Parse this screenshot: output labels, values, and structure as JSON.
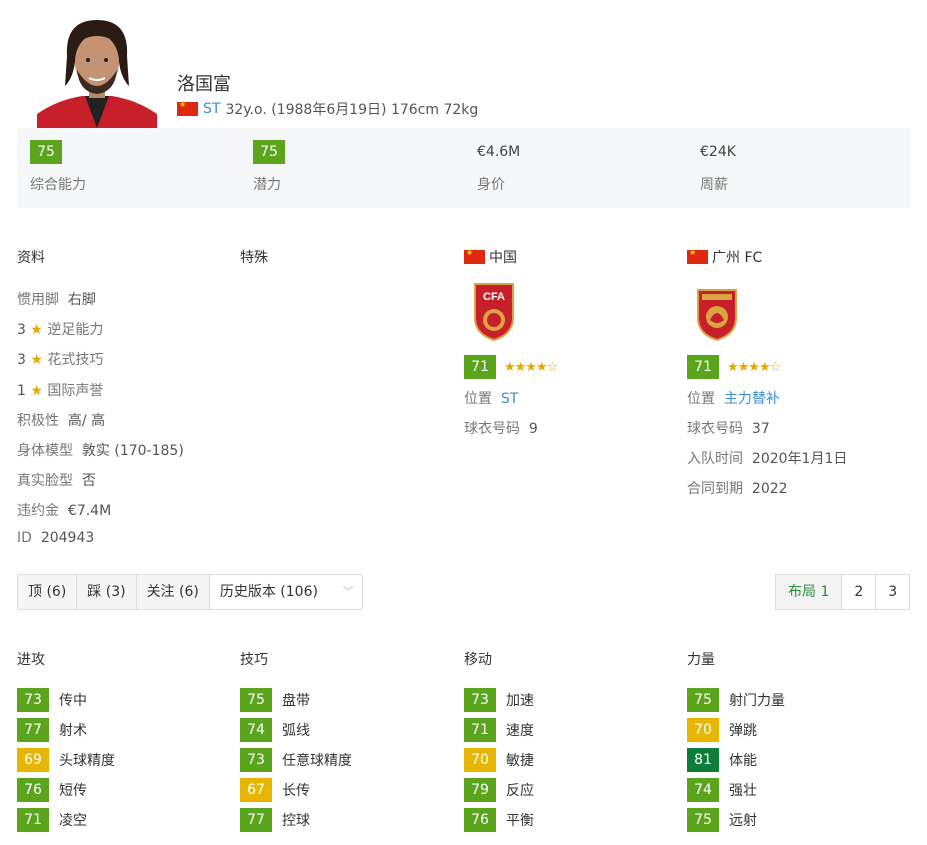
{
  "player": {
    "name": "洛国富",
    "position": "ST",
    "details": "32y.o. (1988年6月19日) 176cm 72kg"
  },
  "summary": [
    {
      "value": "75",
      "label": "综合能力",
      "color": "#5aa51c",
      "boxed": true
    },
    {
      "value": "75",
      "label": "潜力",
      "color": "#5aa51c",
      "boxed": true
    },
    {
      "value": "€4.6M",
      "label": "身价",
      "boxed": false
    },
    {
      "value": "€24K",
      "label": "周薪",
      "boxed": false
    }
  ],
  "profile": {
    "title": "资料",
    "preferred_foot_label": "惯用脚",
    "preferred_foot": "右脚",
    "weak_foot_num": "3",
    "weak_foot_label": "逆足能力",
    "skill_moves_num": "3",
    "skill_moves_label": "花式技巧",
    "reputation_num": "1",
    "reputation_label": "国际声誉",
    "work_rate_label": "积极性",
    "work_rate": "高/ 高",
    "body_label": "身体模型",
    "body": "敦实 (170-185)",
    "real_face_label": "真实脸型",
    "real_face": "否",
    "release_label": "违约金",
    "release": "€7.4M",
    "id_label": "ID",
    "id": "204943"
  },
  "traits": {
    "title": "特殊"
  },
  "national": {
    "name": "中国",
    "rating": "71",
    "stars": "★★★★☆",
    "position_label": "位置",
    "position": "ST",
    "number_label": "球衣号码",
    "number": "9"
  },
  "club": {
    "name": "广州 FC",
    "rating": "71",
    "stars": "★★★★☆",
    "position_label": "位置",
    "position": "主力替补",
    "number_label": "球衣号码",
    "number": "37",
    "joined_label": "入队时间",
    "joined": "2020年1月1日",
    "contract_label": "合同到期",
    "contract": "2022"
  },
  "actions": {
    "like": "顶 (6)",
    "dislike": "踩 (3)",
    "follow": "关注 (6)",
    "history": "历史版本 (106)"
  },
  "layout_pager": {
    "label": "布局 1",
    "p2": "2",
    "p3": "3"
  },
  "attributes": {
    "attacking": {
      "title": "进攻",
      "items": [
        {
          "v": "73",
          "l": "传中",
          "c": "g"
        },
        {
          "v": "77",
          "l": "射术",
          "c": "g"
        },
        {
          "v": "69",
          "l": "头球精度",
          "c": "y"
        },
        {
          "v": "76",
          "l": "短传",
          "c": "g"
        },
        {
          "v": "71",
          "l": "凌空",
          "c": "g"
        }
      ]
    },
    "skill": {
      "title": "技巧",
      "items": [
        {
          "v": "75",
          "l": "盘带",
          "c": "g"
        },
        {
          "v": "74",
          "l": "弧线",
          "c": "g"
        },
        {
          "v": "73",
          "l": "任意球精度",
          "c": "g"
        },
        {
          "v": "67",
          "l": "长传",
          "c": "y"
        },
        {
          "v": "77",
          "l": "控球",
          "c": "g"
        }
      ]
    },
    "movement": {
      "title": "移动",
      "items": [
        {
          "v": "73",
          "l": "加速",
          "c": "g"
        },
        {
          "v": "71",
          "l": "速度",
          "c": "g"
        },
        {
          "v": "70",
          "l": "敏捷",
          "c": "y"
        },
        {
          "v": "79",
          "l": "反应",
          "c": "g"
        },
        {
          "v": "76",
          "l": "平衡",
          "c": "g"
        }
      ]
    },
    "power": {
      "title": "力量",
      "items": [
        {
          "v": "75",
          "l": "射门力量",
          "c": "g"
        },
        {
          "v": "70",
          "l": "弹跳",
          "c": "y"
        },
        {
          "v": "81",
          "l": "体能",
          "c": "dg"
        },
        {
          "v": "74",
          "l": "强壮",
          "c": "g"
        },
        {
          "v": "75",
          "l": "远射",
          "c": "g"
        }
      ]
    }
  }
}
